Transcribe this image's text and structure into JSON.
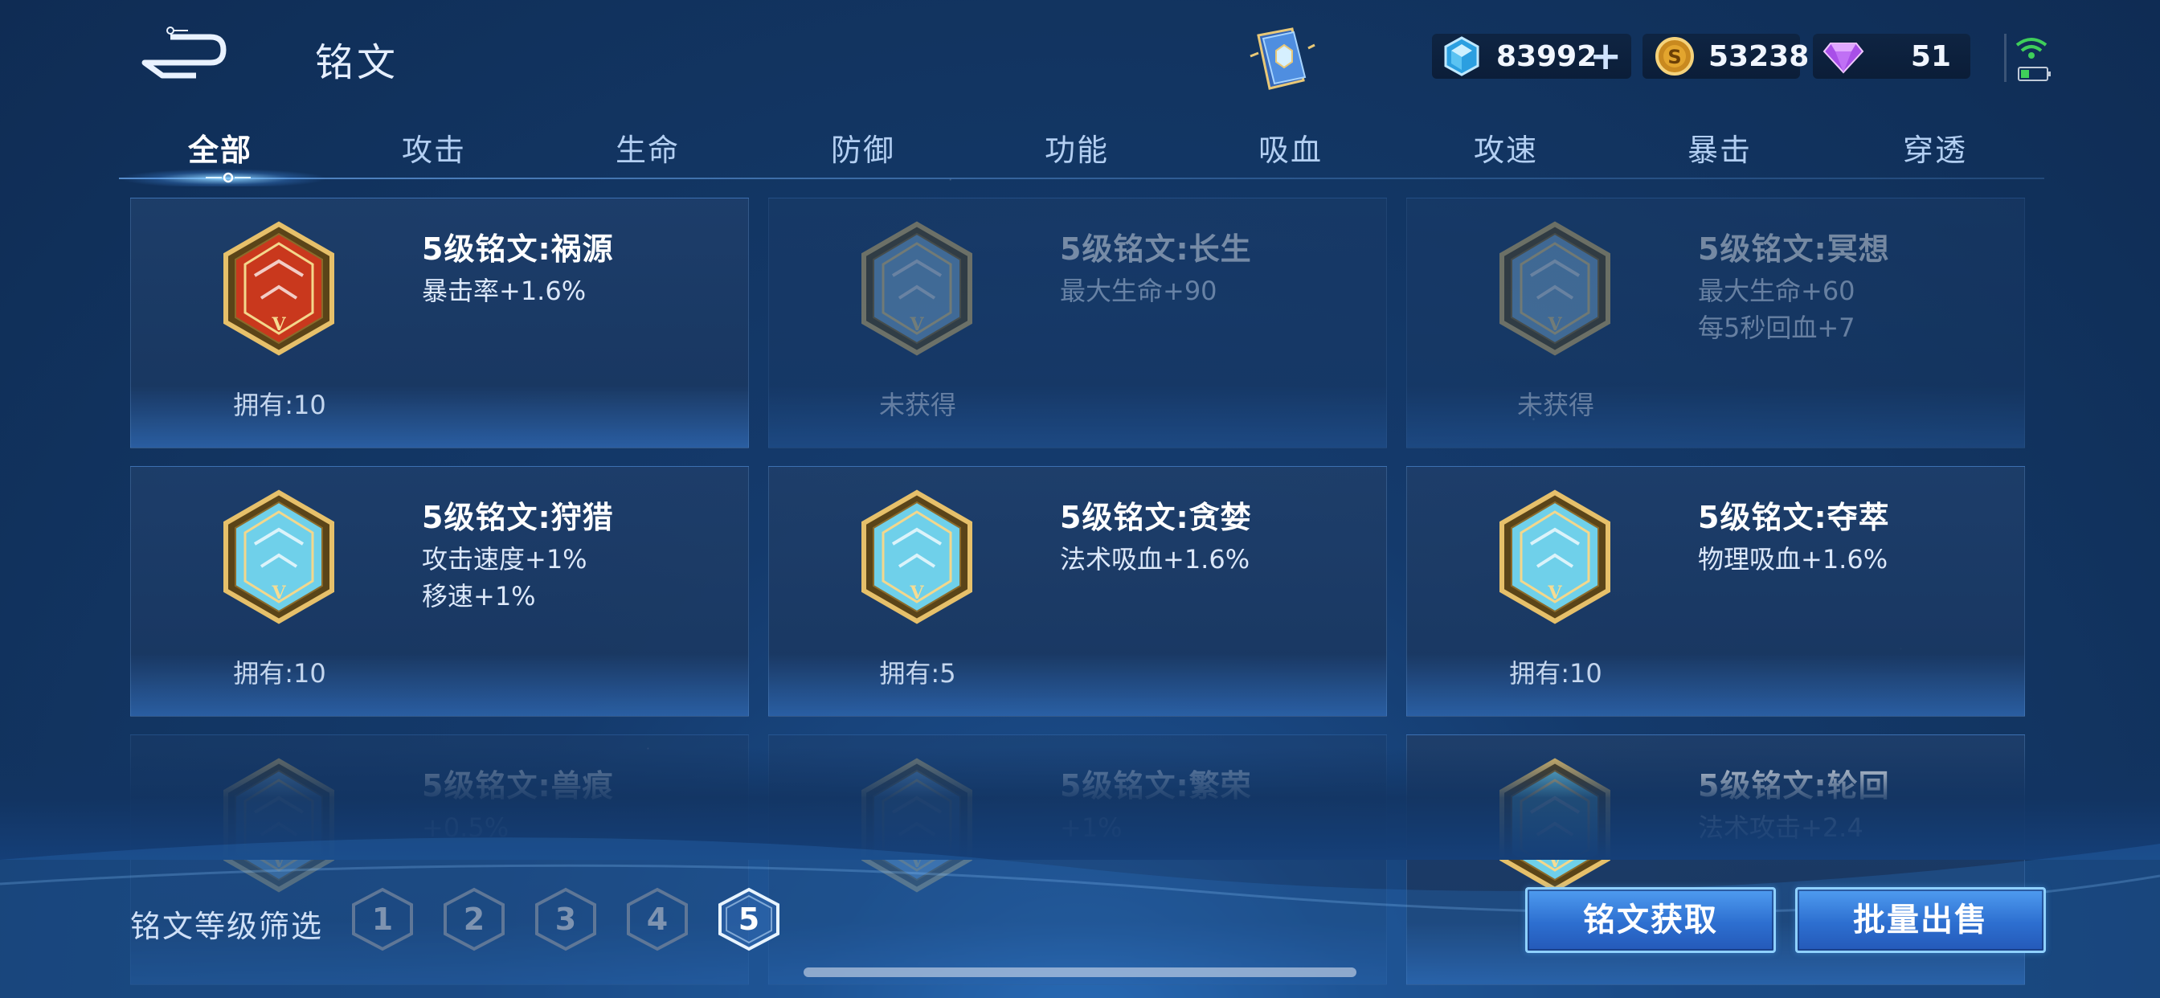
{
  "header": {
    "title": "铭文",
    "back_icon": "back-arrow-icon",
    "book_icon": "rune-book-icon",
    "currency": {
      "diamond": "83992",
      "gold": "53238",
      "gem": "51",
      "plus_label": "+"
    }
  },
  "tabs": [
    {
      "label": "全部",
      "active": true
    },
    {
      "label": "攻击"
    },
    {
      "label": "生命"
    },
    {
      "label": "防御"
    },
    {
      "label": "功能"
    },
    {
      "label": "吸血"
    },
    {
      "label": "攻速"
    },
    {
      "label": "暴击"
    },
    {
      "label": "穿透"
    }
  ],
  "runes": [
    {
      "name": "5级铭文:祸源",
      "stats": [
        "暴击率+1.6%"
      ],
      "owned": "拥有:10",
      "locked": false,
      "color": "#c9381d"
    },
    {
      "name": "5级铭文:长生",
      "stats": [
        "最大生命+90"
      ],
      "owned": "未获得",
      "locked": true,
      "color": "#7fb0d8"
    },
    {
      "name": "5级铭文:冥想",
      "stats": [
        "最大生命+60",
        "每5秒回血+7"
      ],
      "owned": "未获得",
      "locked": true,
      "color": "#7fb0d8"
    },
    {
      "name": "5级铭文:狩猎",
      "stats": [
        "攻击速度+1%",
        "移速+1%"
      ],
      "owned": "拥有:10",
      "locked": false,
      "color": "#6fd0ea"
    },
    {
      "name": "5级铭文:贪婪",
      "stats": [
        "法术吸血+1.6%"
      ],
      "owned": "拥有:5",
      "locked": false,
      "color": "#6fd0ea"
    },
    {
      "name": "5级铭文:夺萃",
      "stats": [
        "物理吸血+1.6%"
      ],
      "owned": "拥有:10",
      "locked": false,
      "color": "#6fd0ea"
    },
    {
      "name": "5级铭文:兽痕",
      "stats": [
        "+0.5%"
      ],
      "owned": "",
      "locked": true,
      "color": "#7fb0d8"
    },
    {
      "name": "5级铭文:繁荣",
      "stats": [
        "+1%"
      ],
      "owned": "",
      "locked": true,
      "color": "#7fb0d8"
    },
    {
      "name": "5级铭文:轮回",
      "stats": [
        "法术攻击+2.4"
      ],
      "owned": "",
      "locked": false,
      "color": "#6fd0ea"
    }
  ],
  "filter": {
    "label": "铭文等级筛选",
    "levels": [
      "1",
      "2",
      "3",
      "4",
      "5"
    ],
    "active_level": "5"
  },
  "buttons": {
    "obtain": "铭文获取",
    "sell": "批量出售"
  }
}
